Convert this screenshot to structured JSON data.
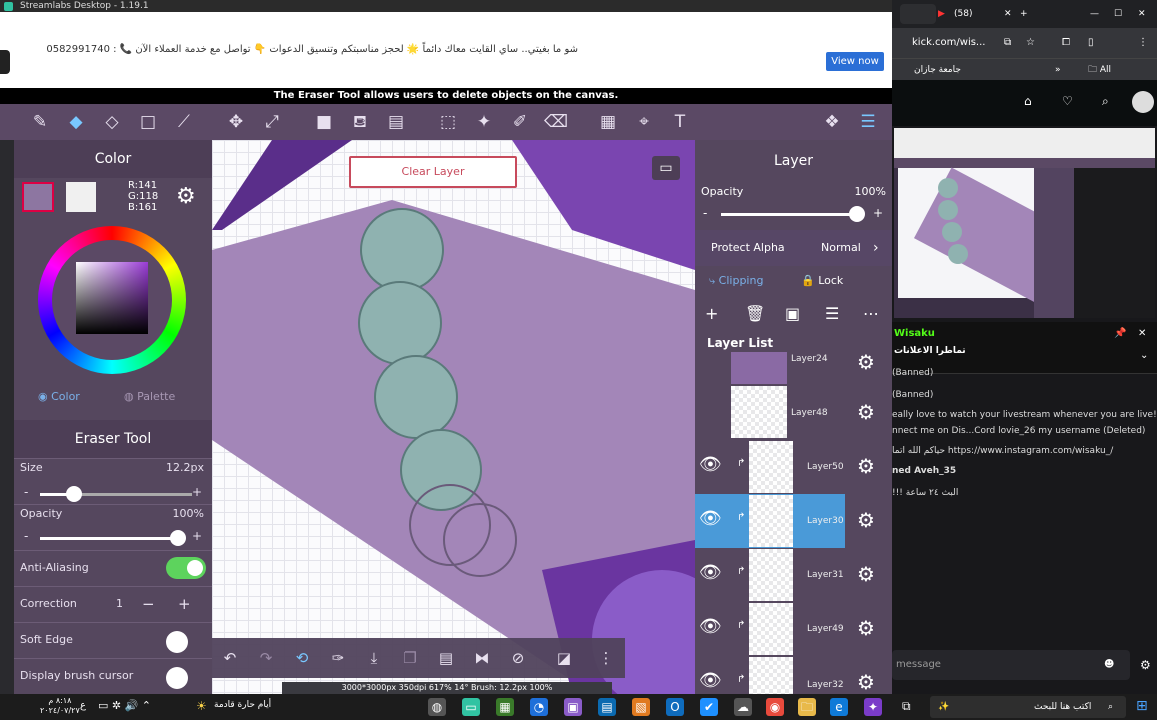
{
  "window": {
    "title": "Streamlabs Desktop - 1.19.1"
  },
  "banner": {
    "text": "شو ما بغيتي.. ساي القايت معاك دائماً 🌟 لحجز مناسبتكم وتنسيق الدعوات 👇 تواصل مع خدمة العملاء الآن 📞 : 0582991740",
    "button": "View now"
  },
  "hint": "The Eraser Tool allows users to delete objects on the canvas.",
  "canvas": {
    "clear_layer": "Clear Layer"
  },
  "color_panel": {
    "title": "Color",
    "r": "R:141",
    "g": "G:118",
    "b": "B:161",
    "tab_color": "Color",
    "tab_palette": "Palette",
    "swatch": "#8d76a1"
  },
  "eraser": {
    "title": "Eraser Tool",
    "size_label": "Size",
    "size_value": "12.2px",
    "opacity_label": "Opacity",
    "opacity_value": "100%",
    "aa_label": "Anti-Aliasing",
    "correction_label": "Correction",
    "correction_value": "1",
    "soft_edge_label": "Soft Edge",
    "cursor_label": "Display brush cursor"
  },
  "layer_panel": {
    "title": "Layer",
    "opacity_label": "Opacity",
    "opacity_value": "100%",
    "protect_alpha": "Protect Alpha",
    "blend": "Normal",
    "clipping": "Clipping",
    "lock": "Lock",
    "list_title": "Layer List",
    "layers": [
      {
        "name": "Layer24"
      },
      {
        "name": "Layer48"
      },
      {
        "name": "Layer50"
      },
      {
        "name": "Layer30"
      },
      {
        "name": "Layer31"
      },
      {
        "name": "Layer49"
      },
      {
        "name": "Layer32"
      }
    ]
  },
  "status": "3000*3000px 350dpi 617% 14° Brush: 12.2px 100%",
  "browser": {
    "tab1": "(58)",
    "address": "kick.com/wis...",
    "bookmark1": "جامعة جازان",
    "bookmarks": "All Bookmarks",
    "channel": "Wisaku",
    "pinned": "تماطرا الاعلانات",
    "chat": [
      "(Banned)",
      "(Banned)",
      "eally love to watch your livestream whenever you are live!",
      "nnect me on Dis...Cord lovie_26 my username (Deleted)",
      "حياكم الله اتما https://www.instagram.com/wisaku_/",
      "ned Aveh_35",
      "!!! البث ٢٤ ساعة"
    ],
    "message_placeholder": "message"
  },
  "taskbar": {
    "weather": "أيام حارة قادمة",
    "search": "اكتب هنا للبحث",
    "time": "٨:١٨ م",
    "date": "٢٠٢٤/٠٧/٢٧",
    "lang": "ع"
  }
}
